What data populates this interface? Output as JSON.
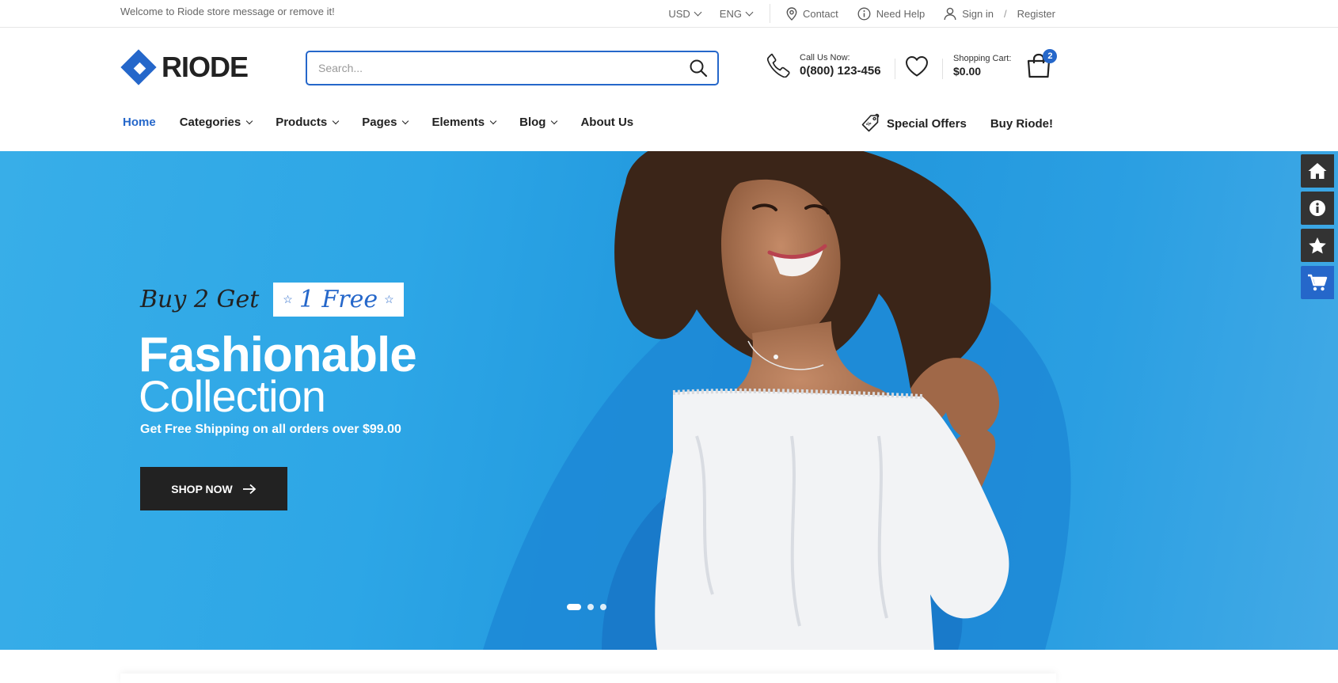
{
  "topbar": {
    "welcome": "Welcome to Riode store message or remove it!",
    "currency": "USD",
    "language": "ENG",
    "contact": "Contact",
    "need_help": "Need Help",
    "sign_in": "Sign in",
    "slash": "/",
    "register": "Register"
  },
  "header": {
    "logo_text": "RIODE",
    "search": {
      "placeholder": "Search...",
      "value": ""
    },
    "call_label": "Call Us Now:",
    "phone": "0(800) 123-456",
    "cart_label": "Shopping Cart:",
    "cart_total": "$0.00",
    "cart_count": "2"
  },
  "nav": {
    "items": [
      {
        "label": "Home",
        "dropdown": false,
        "active": true
      },
      {
        "label": "Categories",
        "dropdown": true
      },
      {
        "label": "Products",
        "dropdown": true
      },
      {
        "label": "Pages",
        "dropdown": true
      },
      {
        "label": "Elements",
        "dropdown": true
      },
      {
        "label": "Blog",
        "dropdown": true
      },
      {
        "label": "About Us",
        "dropdown": false
      }
    ],
    "special_offers": "Special Offers",
    "buy": "Buy Riode!"
  },
  "hero": {
    "promo_prefix": "Buy 2 Get",
    "promo_badge": "1 Free",
    "title_line1": "Fashionable",
    "title_line2": "Collection",
    "subtitle": "Get Free Shipping on all orders over $99.00",
    "button": "SHOP NOW",
    "slides": 3,
    "active_slide": 1
  },
  "side_widgets": [
    {
      "icon": "home-icon"
    },
    {
      "icon": "info-icon"
    },
    {
      "icon": "star-icon"
    },
    {
      "icon": "cart-icon"
    }
  ],
  "colors": {
    "brand": "#2567ca",
    "hero_bg": "#2da6e6",
    "dark": "#222222"
  }
}
